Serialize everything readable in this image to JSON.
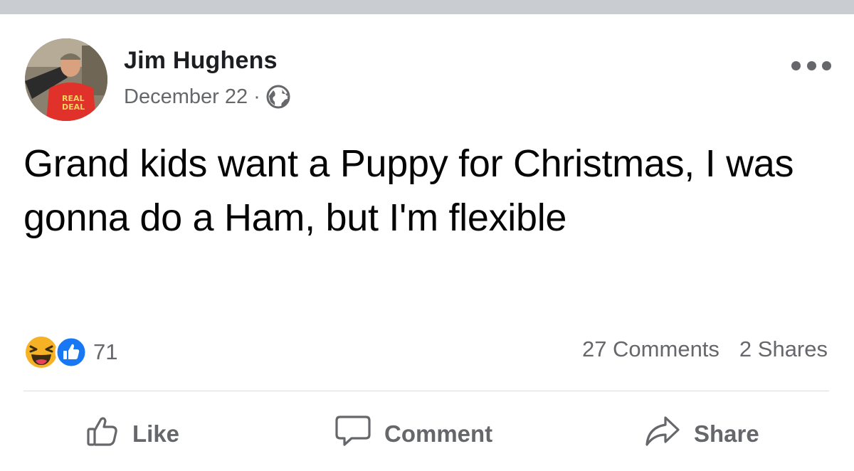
{
  "post": {
    "author": "Jim Hughens",
    "date": "December 22",
    "separator": "·",
    "privacy_icon": "globe-icon",
    "avatar_shirt_text": [
      "REAL",
      "DEAL"
    ],
    "text": "Grand kids want a Puppy for Christmas, I was gonna do a Ham, but I'm flexible"
  },
  "stats": {
    "reaction_count": "71",
    "reaction_icons": [
      "haha-icon",
      "like-reaction-icon"
    ],
    "comments": "27 Comments",
    "shares": "2 Shares"
  },
  "actions": {
    "like": "Like",
    "comment": "Comment",
    "share": "Share"
  },
  "colors": {
    "text_primary": "#050505",
    "text_secondary": "#65676b",
    "like_blue": "#1877f2",
    "haha_yellow": "#f7b125",
    "divider": "#dadde1"
  }
}
